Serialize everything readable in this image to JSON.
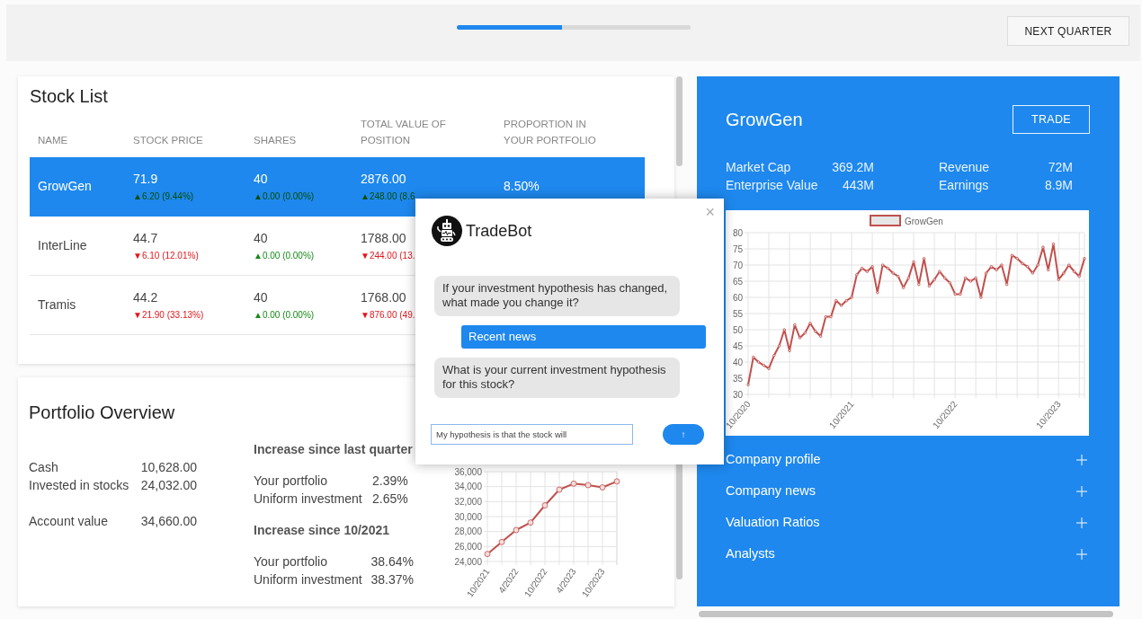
{
  "top_bar": {
    "progress": {
      "level": 0.45
    },
    "next_button": "NEXT QUARTER"
  },
  "stock_list": {
    "title": "Stock List",
    "columns": [
      "NAME",
      "STOCK PRICE",
      "SHARES",
      "TOTAL VALUE OF POSITION",
      "PROPORTION IN YOUR PORTFOLIO"
    ],
    "rows": [
      {
        "name": "GrowGen",
        "selected": true,
        "price": "71.9",
        "price_change": {
          "text": "▲6.20 (9.44%)",
          "falling": false
        },
        "shares": "40",
        "shares_change": {
          "text": "▲0.00 (0.00%)",
          "falling": false
        },
        "value": "2876.00",
        "value_change": {
          "text": "▲248.00 (8.6",
          "falling": false
        },
        "proportion": "8.50%"
      },
      {
        "name": "InterLine",
        "selected": false,
        "price": "44.7",
        "price_change": {
          "text": "▼6.10 (12.01%)",
          "falling": true
        },
        "shares": "40",
        "shares_change": {
          "text": "▲0.00 (0.00%)",
          "falling": false
        },
        "value": "1788.00",
        "value_change": {
          "text": "▼244.00 (13.",
          "falling": true
        }
      },
      {
        "name": "Tramis",
        "selected": false,
        "price": "44.2",
        "price_change": {
          "text": "▼21.90 (33.13%)",
          "falling": true
        },
        "shares": "40",
        "shares_change": {
          "text": "▲0.00 (0.00%)",
          "falling": false
        },
        "value": "1768.00",
        "value_change": {
          "text": "▼876.00 (49.",
          "falling": true
        }
      }
    ]
  },
  "portfolio_overview": {
    "title": "Portfolio Overview",
    "balance_groups": [
      [
        {
          "label": "Cash",
          "value": "10,628.00"
        },
        {
          "label": "Invested in stocks",
          "value": "24,032.00"
        }
      ],
      [
        {
          "label": "Account value",
          "value": "34,660.00"
        }
      ]
    ],
    "increases": [
      {
        "heading": "Increase since last quarter",
        "rows": [
          {
            "label": "Your portfolio",
            "value": "2.39%"
          },
          {
            "label": "Uniform investment",
            "value": "2.65%"
          }
        ]
      },
      {
        "heading": "Increase since 10/2021",
        "rows": [
          {
            "label": "Your portfolio",
            "value": "38.64%"
          },
          {
            "label": "Uniform investment",
            "value": "38.37%"
          }
        ]
      }
    ],
    "chart_data": {
      "type": "line",
      "grid": true,
      "categories": [
        "10/2021",
        null,
        "4/2022",
        null,
        "10/2022",
        null,
        "4/2023",
        null,
        "10/2023",
        null
      ],
      "ylim": [
        24000,
        36000
      ],
      "yticks": [
        {
          "value": 24000,
          "label": "24,000"
        },
        {
          "value": 26000,
          "label": "26,000"
        },
        {
          "value": 28000,
          "label": "28,000"
        },
        {
          "value": 30000,
          "label": "30,000"
        },
        {
          "value": 32000,
          "label": "32,000"
        },
        {
          "value": 34000,
          "label": "34,000"
        },
        {
          "value": 36000,
          "label": "36,000"
        }
      ],
      "series": [
        {
          "color": "#c0504d",
          "marker": "circle",
          "values": [
            25000,
            26600,
            28200,
            29200,
            31500,
            33600,
            34400,
            34200,
            33900,
            34700
          ]
        }
      ]
    }
  },
  "company_panel": {
    "name": "GrowGen",
    "trade_button": "TRADE",
    "stat_columns": [
      [
        {
          "label": "Market Cap",
          "value": "369.2M"
        },
        {
          "label": "Enterprise Value",
          "value": "443M"
        }
      ],
      [
        {
          "label": "Revenue",
          "value": "72M"
        },
        {
          "label": "Earnings",
          "value": "8.9M"
        }
      ]
    ],
    "chart_data": {
      "type": "line",
      "grid": true,
      "categories": [
        "10/2020",
        null,
        null,
        null,
        null,
        null,
        null,
        null,
        null,
        null,
        null,
        null,
        null,
        null,
        null,
        null,
        null,
        null,
        null,
        null,
        "10/2021",
        null,
        null,
        null,
        null,
        null,
        null,
        null,
        null,
        null,
        null,
        null,
        null,
        null,
        null,
        null,
        null,
        null,
        null,
        null,
        "10/2022",
        null,
        null,
        null,
        null,
        null,
        null,
        null,
        null,
        null,
        null,
        null,
        null,
        null,
        null,
        null,
        null,
        null,
        null,
        null,
        "10/2023",
        null,
        null,
        null,
        null,
        null
      ],
      "ylim": [
        30,
        80
      ],
      "yticks": [
        {
          "value": 30,
          "label": "30"
        },
        {
          "value": 35,
          "label": "35"
        },
        {
          "value": 40,
          "label": "40"
        },
        {
          "value": 45,
          "label": "45"
        },
        {
          "value": 50,
          "label": "50"
        },
        {
          "value": 55,
          "label": "55"
        },
        {
          "value": 60,
          "label": "60"
        },
        {
          "value": 65,
          "label": "65"
        },
        {
          "value": 70,
          "label": "70"
        },
        {
          "value": 75,
          "label": "75"
        },
        {
          "value": 80,
          "label": "80"
        }
      ],
      "series": [
        {
          "name": "GrowGen",
          "color": "#c0504d",
          "marker": "circle",
          "values": [
            33,
            41.5,
            40,
            39,
            38,
            42,
            45,
            50,
            43.5,
            51.5,
            47.5,
            49,
            52,
            49.5,
            48,
            54,
            54,
            59,
            57.5,
            59,
            60,
            67,
            69,
            68,
            69.5,
            61.5,
            70,
            69,
            67.5,
            66.5,
            63,
            66,
            71,
            64,
            72,
            63.5,
            65.5,
            68,
            66,
            64.5,
            61,
            61,
            66,
            65,
            66,
            60,
            67.5,
            69.5,
            68.5,
            70,
            64,
            73,
            72,
            70.5,
            69.5,
            67.5,
            70,
            75.5,
            68.5,
            76.5,
            65.5,
            67.5,
            70,
            68,
            66.5,
            72
          ]
        }
      ]
    },
    "sections": [
      {
        "label": "Company profile",
        "expanded": false
      },
      {
        "label": "Company news",
        "expanded": false
      },
      {
        "label": "Valuation Ratios",
        "expanded": false
      },
      {
        "label": "Analysts",
        "expanded": false
      }
    ]
  },
  "chat_dialog": {
    "title": "TradeBot",
    "close": "×",
    "messages": [
      {
        "kind": "bot",
        "text": "If your investment hypothesis has changed, what made you change it?"
      },
      {
        "kind": "user",
        "text": "Recent news"
      },
      {
        "kind": "bot",
        "text": "What is your current investment hypothesis for this stock?"
      }
    ],
    "input": {
      "value": "My hypothesis is that the stock will"
    },
    "send": "↑"
  }
}
